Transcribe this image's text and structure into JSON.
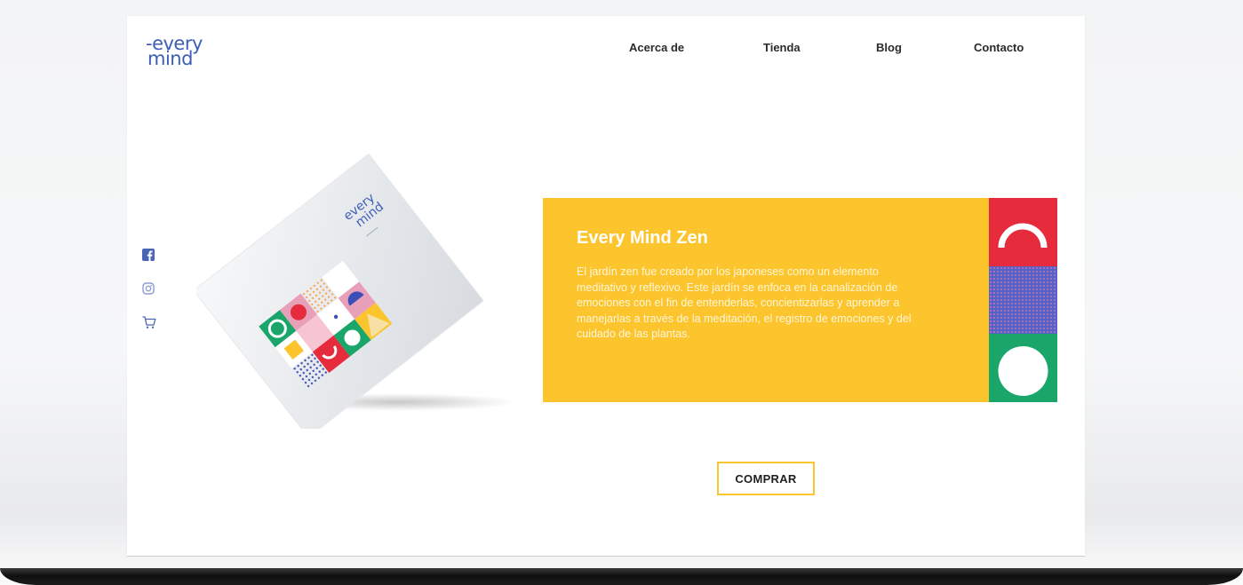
{
  "brand": {
    "logo_line1": "-every",
    "logo_line2": "mind"
  },
  "nav": [
    {
      "label": "Acerca de"
    },
    {
      "label": "Tienda"
    },
    {
      "label": "Blog"
    },
    {
      "label": "Contacto"
    }
  ],
  "social": {
    "icons": [
      "facebook-icon",
      "instagram-icon",
      "cart-icon"
    ]
  },
  "product": {
    "box_logo": "every mind",
    "title": "Every Mind Zen",
    "description": "El jardín zen fue creado por los japoneses como un elemento meditativo y reflexivo. Este jardín se enfoca en la canalización de emociones con el fin de entenderlas, concientizarlas y aprender a manejarlas a través de la meditación, el registro de emociones y del cuidado de las plantas.",
    "cta_label": "COMPRAR"
  },
  "colors": {
    "brand_blue": "#3d5eb8",
    "panel_yellow": "#fcc52d",
    "swatch_red": "#e52b3c",
    "swatch_blue": "#5562c9",
    "swatch_green": "#1aa56a",
    "tile_pink": "#e8a0b8"
  }
}
